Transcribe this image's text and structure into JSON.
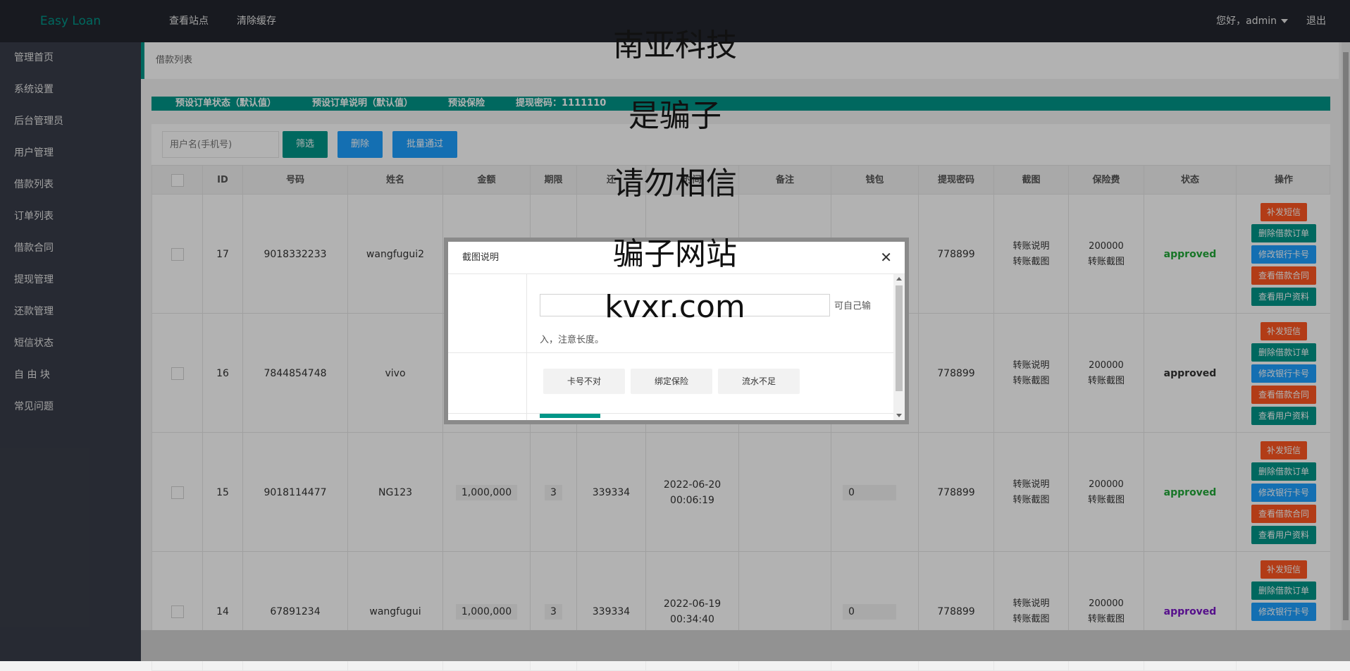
{
  "header": {
    "logo": "Easy Loan",
    "nav": [
      "查看站点",
      "清除缓存"
    ],
    "greeting": "您好，admin",
    "logout": "退出"
  },
  "sidebar": {
    "items": [
      "管理首页",
      "系统设置",
      "后台管理员",
      "用户管理",
      "借款列表",
      "订单列表",
      "借款合同",
      "提现管理",
      "还款管理",
      "短信状态",
      "自 由 块",
      "常见问题"
    ]
  },
  "breadcrumb": "借款列表",
  "presets": {
    "order_status": "预设订单状态（默认值）",
    "order_note": "预设订单说明（默认值）",
    "insurance": "预设保险",
    "withdraw_code": "提现密码：1111110"
  },
  "filter": {
    "placeholder": "用户名(手机号)",
    "filter_btn": "筛选",
    "delete_btn": "删除",
    "batch_btn": "批量通过"
  },
  "table": {
    "headers": [
      "ID",
      "号码",
      "姓名",
      "金额",
      "期限",
      "还",
      "时间",
      "备注",
      "钱包",
      "提现密码",
      "截图",
      "保险费",
      "状态",
      "操作"
    ],
    "rows": [
      {
        "id": "17",
        "phone": "9018332233",
        "name": "wangfugui2",
        "amount": "",
        "term": "",
        "repay": "",
        "time1": "",
        "time2": "",
        "note": "",
        "wallet": "",
        "code": "778899",
        "shot1": "转账说明",
        "shot2": "转账截图",
        "fee1": "200000",
        "fee2": "转账截图",
        "status": "approved"
      },
      {
        "id": "16",
        "phone": "7844854748",
        "name": "vivo",
        "amount": "",
        "term": "",
        "repay": "",
        "time1": "",
        "time2": "",
        "note": "",
        "wallet": "",
        "code": "778899",
        "shot1": "转账说明",
        "shot2": "转账截图",
        "fee1": "200000",
        "fee2": "转账截图",
        "status": "approved"
      },
      {
        "id": "15",
        "phone": "9018114477",
        "name": "NG123",
        "amount": "1,000,000",
        "term": "3",
        "repay": "339334",
        "time1": "2022-06-20",
        "time2": "00:06:19",
        "note": "",
        "wallet": "0",
        "code": "778899",
        "shot1": "转账说明",
        "shot2": "转账截图",
        "fee1": "200000",
        "fee2": "转账截图",
        "status": "approved"
      },
      {
        "id": "14",
        "phone": "67891234",
        "name": "wangfugui",
        "amount": "1,000,000",
        "term": "3",
        "repay": "339334",
        "time1": "2022-06-19",
        "time2": "00:34:40",
        "note": "",
        "wallet": "0",
        "code": "778899",
        "shot1": "转账说明",
        "shot2": "转账截图",
        "fee1": "200000",
        "fee2": "转账截图",
        "status": "approved"
      }
    ],
    "ops": [
      "补发短信",
      "删除借款订单",
      "修改银行卡号",
      "查看借款合同",
      "查看用户资料"
    ]
  },
  "dialog": {
    "title": "截图说明",
    "hint1": "可自己输",
    "hint2": "入，注意长度。",
    "buttons": [
      "卡号不对",
      "绑定保险",
      "流水不足"
    ]
  },
  "watermark": [
    "南亚科技",
    "是骗子",
    "请勿相信",
    "骗子网站",
    "kvxr.com"
  ],
  "colors": {
    "accent": "#009688",
    "blue": "#1e9fff",
    "orange": "#ff5722",
    "approved_green": "#22a838",
    "approved_purple": "#7b18c8"
  }
}
